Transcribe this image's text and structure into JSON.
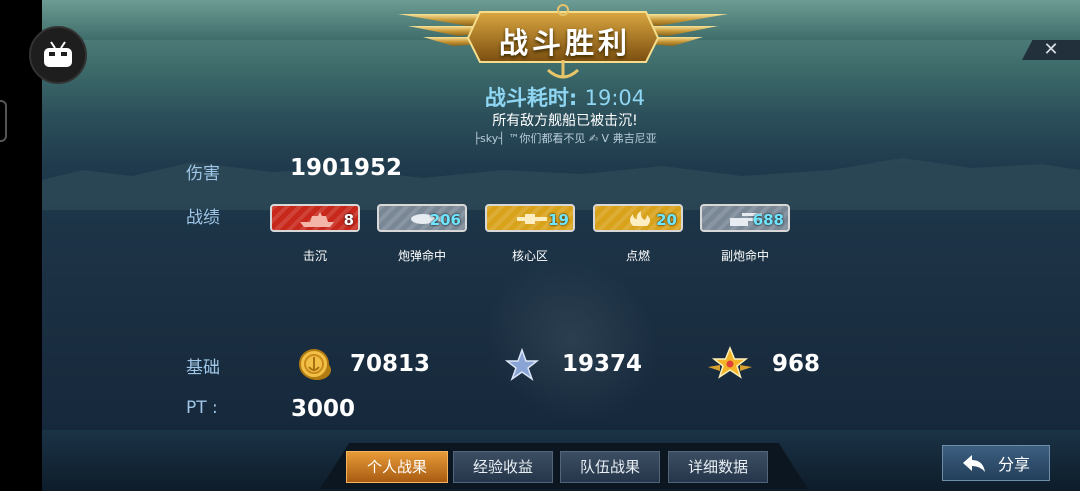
{
  "title": "战斗胜利",
  "battle_time": {
    "label": "战斗耗时:",
    "value": "19:04"
  },
  "sunk_message": "所有敌方舰船已被击沉!",
  "players_line": "├sky┤ ™你们都看不见 ✍ V 弗吉尼亚",
  "damage": {
    "label": "伤害",
    "value": "1901952"
  },
  "record": {
    "label": "战绩",
    "items": [
      {
        "label": "击沉",
        "value": "8",
        "color": "#c8281c",
        "icon": "warship-icon"
      },
      {
        "label": "炮弹命中",
        "value": "206",
        "color": "#7a8896",
        "icon": "shell-icon"
      },
      {
        "label": "核心区",
        "value": "19",
        "color": "#d8a21a",
        "icon": "cannon-icon"
      },
      {
        "label": "点燃",
        "value": "20",
        "color": "#d8a21a",
        "icon": "fire-icon"
      },
      {
        "label": "副炮命中",
        "value": "688",
        "color": "#7a8896",
        "icon": "turret-icon"
      }
    ]
  },
  "base": {
    "label": "基础",
    "gold": "70813",
    "silver_star": "19374",
    "gold_star": "968"
  },
  "pt": {
    "label": "PT :",
    "value": "3000"
  },
  "tabs": [
    "个人战果",
    "经验收益",
    "队伍战果",
    "详细数据"
  ],
  "share_label": "分享",
  "close_label": "✕",
  "colors": {
    "accent_gold": "#e9a23c",
    "label_blue": "#9fc6e6",
    "time_cyan": "#8fd6f3"
  }
}
